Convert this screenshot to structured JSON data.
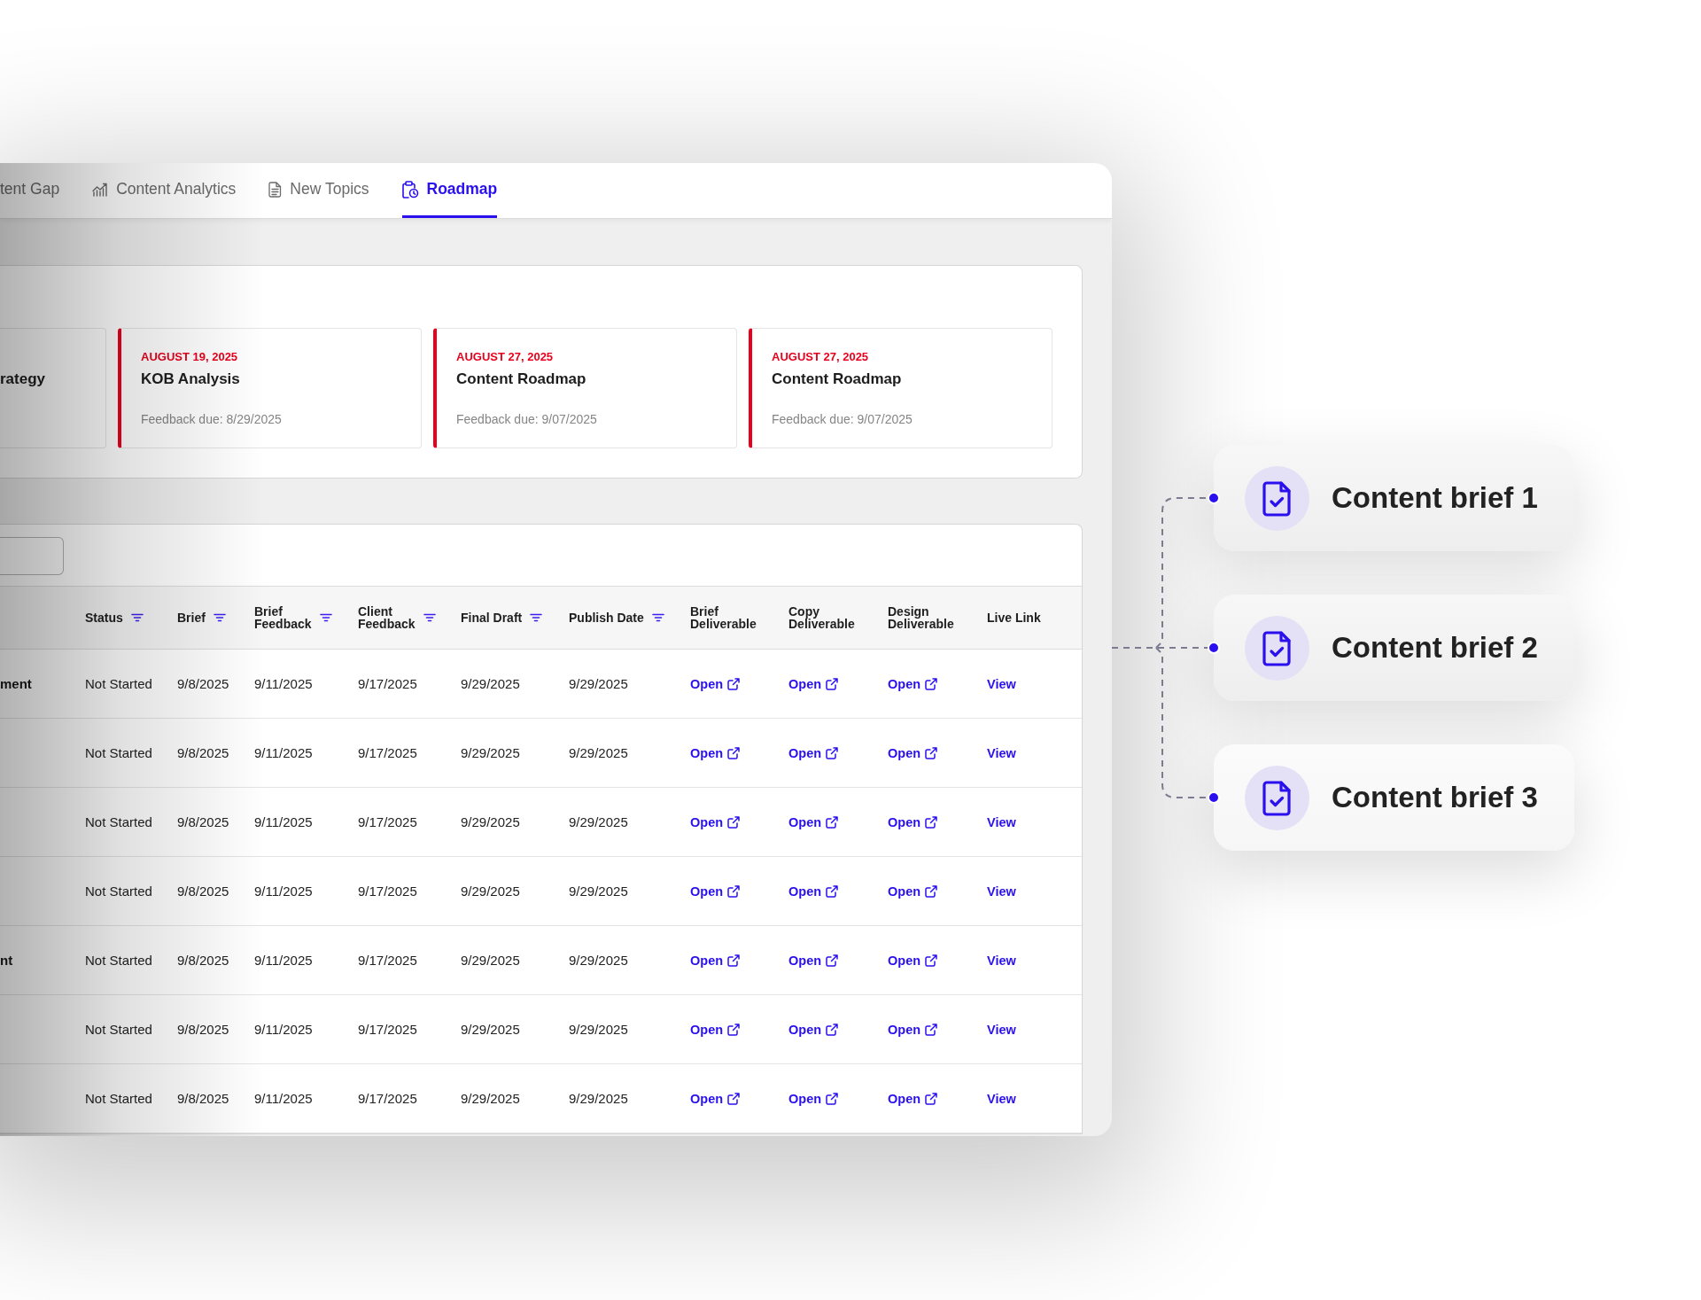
{
  "tabs": [
    {
      "label": "tent Gap",
      "kind": "plain",
      "selected": false
    },
    {
      "label": "Content Analytics",
      "kind": "analytics",
      "selected": false
    },
    {
      "label": "New Topics",
      "kind": "topics",
      "selected": false
    },
    {
      "label": "Roadmap",
      "kind": "roadmap",
      "selected": true
    }
  ],
  "milestones": [
    {
      "title": "rategy"
    },
    {
      "date": "AUGUST 19, 2025",
      "title": "KOB Analysis",
      "feedback": "Feedback due: 8/29/2025"
    },
    {
      "date": "AUGUST 27, 2025",
      "title": "Content Roadmap",
      "feedback": "Feedback due: 9/07/2025"
    },
    {
      "date": "AUGUST 27, 2025",
      "title": "Content Roadmap",
      "feedback": "Feedback due: 9/07/2025"
    }
  ],
  "table": {
    "columns": [
      {
        "label": "Status",
        "kind": "text",
        "filter": true
      },
      {
        "label": "Brief",
        "kind": "text",
        "filter": true
      },
      {
        "label": "Brief\nFeedback",
        "kind": "text",
        "filter": true
      },
      {
        "label": "Client\nFeedback",
        "kind": "text",
        "filter": true
      },
      {
        "label": "Final Draft",
        "kind": "text",
        "filter": true
      },
      {
        "label": "Publish Date",
        "kind": "text",
        "filter": true
      },
      {
        "label": "Brief\nDeliverable",
        "kind": "external",
        "filter": false
      },
      {
        "label": "Copy\nDeliverable",
        "kind": "external",
        "filter": false
      },
      {
        "label": "Design\nDeliverable",
        "kind": "external",
        "filter": false
      },
      {
        "label": "Live Link",
        "kind": "link",
        "filter": false
      }
    ],
    "rows": [
      {
        "column_1": "ment",
        "cells": [
          "Not Started",
          "9/8/2025",
          "9/11/2025",
          "9/17/2025",
          "9/29/2025",
          "9/29/2025",
          "Open",
          "Open",
          "Open",
          "View"
        ]
      },
      {
        "cells": [
          "Not Started",
          "9/8/2025",
          "9/11/2025",
          "9/17/2025",
          "9/29/2025",
          "9/29/2025",
          "Open",
          "Open",
          "Open",
          "View"
        ]
      },
      {
        "cells": [
          "Not Started",
          "9/8/2025",
          "9/11/2025",
          "9/17/2025",
          "9/29/2025",
          "9/29/2025",
          "Open",
          "Open",
          "Open",
          "View"
        ]
      },
      {
        "cells": [
          "Not Started",
          "9/8/2025",
          "9/11/2025",
          "9/17/2025",
          "9/29/2025",
          "9/29/2025",
          "Open",
          "Open",
          "Open",
          "View"
        ]
      },
      {
        "column_1": "nt",
        "cells": [
          "Not Started",
          "9/8/2025",
          "9/11/2025",
          "9/17/2025",
          "9/29/2025",
          "9/29/2025",
          "Open",
          "Open",
          "Open",
          "View"
        ]
      },
      {
        "cells": [
          "Not Started",
          "9/8/2025",
          "9/11/2025",
          "9/17/2025",
          "9/29/2025",
          "9/29/2025",
          "Open",
          "Open",
          "Open",
          "View"
        ]
      },
      {
        "cells": [
          "Not Started",
          "9/8/2025",
          "9/11/2025",
          "9/17/2025",
          "9/29/2025",
          "9/29/2025",
          "Open",
          "Open",
          "Open",
          "View"
        ]
      }
    ]
  },
  "briefs": [
    {
      "title": "Content brief 1"
    },
    {
      "title": "Content brief 2"
    },
    {
      "title": "Content brief 3"
    }
  ]
}
